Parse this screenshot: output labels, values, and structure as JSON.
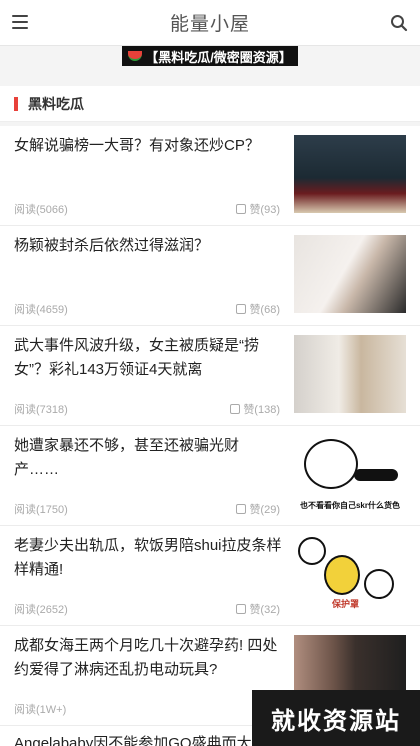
{
  "header": {
    "title": "能量小屋"
  },
  "banner": {
    "text": "【黑料吃瓜/微密圈资源】"
  },
  "section": {
    "title": "黑料吃瓜"
  },
  "articles": [
    {
      "title": "女解说骗榜一大哥？有对象还炒CP？",
      "reads": "阅读(5066)",
      "likes": "赞(93)"
    },
    {
      "title": "杨颖被封杀后依然过得滋润？",
      "reads": "阅读(4659)",
      "likes": "赞(68)"
    },
    {
      "title": "武大事件风波升级，女主被质疑是“捞女”？彩礼143万领证4天就离",
      "reads": "阅读(7318)",
      "likes": "赞(138)"
    },
    {
      "title": "她遭家暴还不够，甚至还被骗光财产……",
      "reads": "阅读(1750)",
      "likes": "赞(29)",
      "caption": "也不看看你自己skr什么货色"
    },
    {
      "title": "老妻少夫出轨瓜，软饭男陪shui拉皮条样样精通!",
      "reads": "阅读(2652)",
      "likes": "赞(32)",
      "caption": "保护罩"
    },
    {
      "title": "成都女海王两个月吃几十次避孕药! 四处约爱得了淋病还乱扔电动玩具?",
      "reads": "阅读(1W+)",
      "likes": ""
    }
  ],
  "partial_article": {
    "title": "Angelababy因不能参加GQ盛典而大哭"
  },
  "watermark": {
    "text": "就收资源站"
  },
  "colors": {
    "accent": "#e8413a",
    "banner_bg": "#111111"
  }
}
